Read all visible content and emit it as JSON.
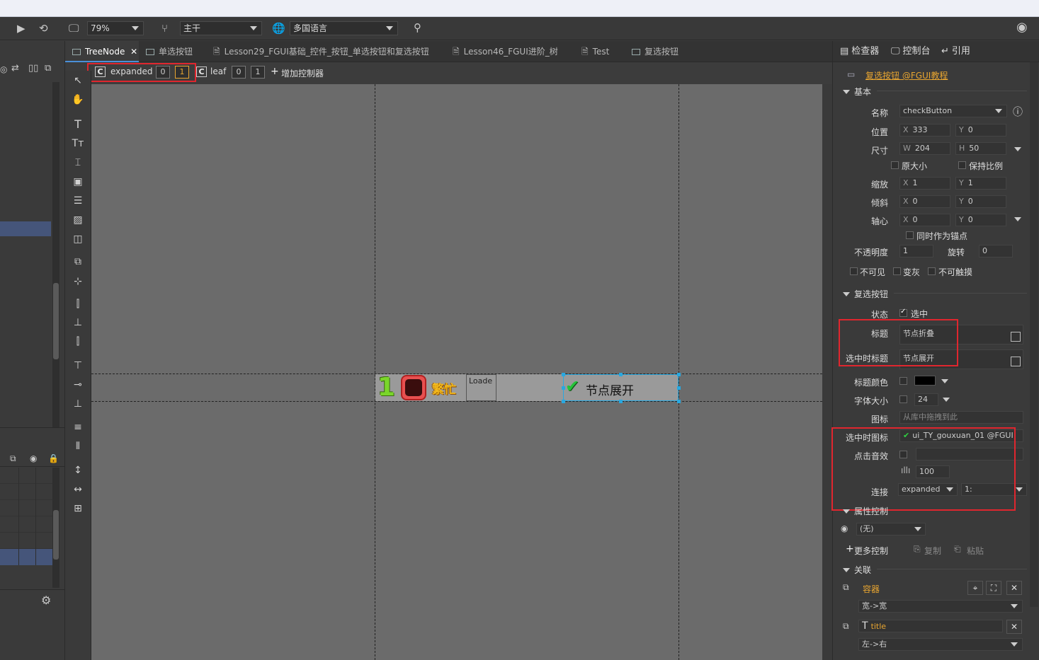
{
  "toolbar": {
    "zoom": "79%",
    "branch": "主干",
    "language": "多国语言"
  },
  "tabs": [
    {
      "label": "TreeNode",
      "active": true
    },
    {
      "label": "单选按钮"
    },
    {
      "label": "Lesson29_FGUI基础_控件_按钮_单选按钮和复选按钮"
    },
    {
      "label": "Lesson46_FGUI进阶_树"
    },
    {
      "label": "Test"
    },
    {
      "label": "复选按钮"
    }
  ],
  "controllers": [
    {
      "name": "expanded",
      "page0": "0",
      "page1": "1"
    },
    {
      "name": "leaf",
      "page0": "0",
      "page1": "1"
    }
  ],
  "add_controller": "增加控制器",
  "stage": {
    "badge_number": "1",
    "busy_text": "繁忙",
    "loader_text": "Loade",
    "button_title": "节点展开"
  },
  "inspector": {
    "tabs": [
      "检查器",
      "控制台",
      "引用"
    ],
    "object_link": "复选按钮 @FGUI教程",
    "basic": {
      "header": "基本",
      "name_label": "名称",
      "name_value": "checkButton",
      "pos_label": "位置",
      "x": "333",
      "y": "0",
      "size_label": "尺寸",
      "w": "204",
      "h": "50",
      "orig_size": "原大小",
      "keep_ratio": "保持比例",
      "scale_label": "缩放",
      "sx": "1",
      "sy": "1",
      "skew_label": "倾斜",
      "kx": "0",
      "ky": "0",
      "pivot_label": "轴心",
      "px": "0",
      "py": "0",
      "as_anchor": "同时作为锚点",
      "alpha_label": "不透明度",
      "alpha": "1",
      "rotation_label": "旋转",
      "rotation": "0",
      "invisible": "不可见",
      "gray": "变灰",
      "untouchable": "不可触摸"
    },
    "button": {
      "header": "复选按钮",
      "state_label": "状态",
      "state_value": "选中",
      "title_label": "标题",
      "title_value": "节点折叠",
      "selected_title_label": "选中时标题",
      "selected_title_value": "节点展开",
      "title_color_label": "标题颜色",
      "font_size_label": "字体大小",
      "font_size": "24",
      "icon_label": "图标",
      "icon_placeholder": "从库中拖拽到此",
      "selected_icon_label": "选中时图标",
      "selected_icon_value": "ui_TY_gouxuan_01 @FGUI",
      "click_sound_label": "点击音效",
      "volume": "100",
      "link_label": "连接",
      "link_controller": "expanded",
      "link_page": "1:"
    },
    "gear": {
      "header": "属性控制",
      "visible_value": "(无)",
      "more": "更多控制",
      "copy": "复制",
      "paste": "粘贴"
    },
    "relations": {
      "header": "关联",
      "target1": "容器",
      "rule1": "宽->宽",
      "target2": "title",
      "rule2": "左->右"
    }
  },
  "colors": {
    "accent": "#e8a530",
    "highlight_red": "#e0262e",
    "selection_blue": "#29a8e0"
  }
}
